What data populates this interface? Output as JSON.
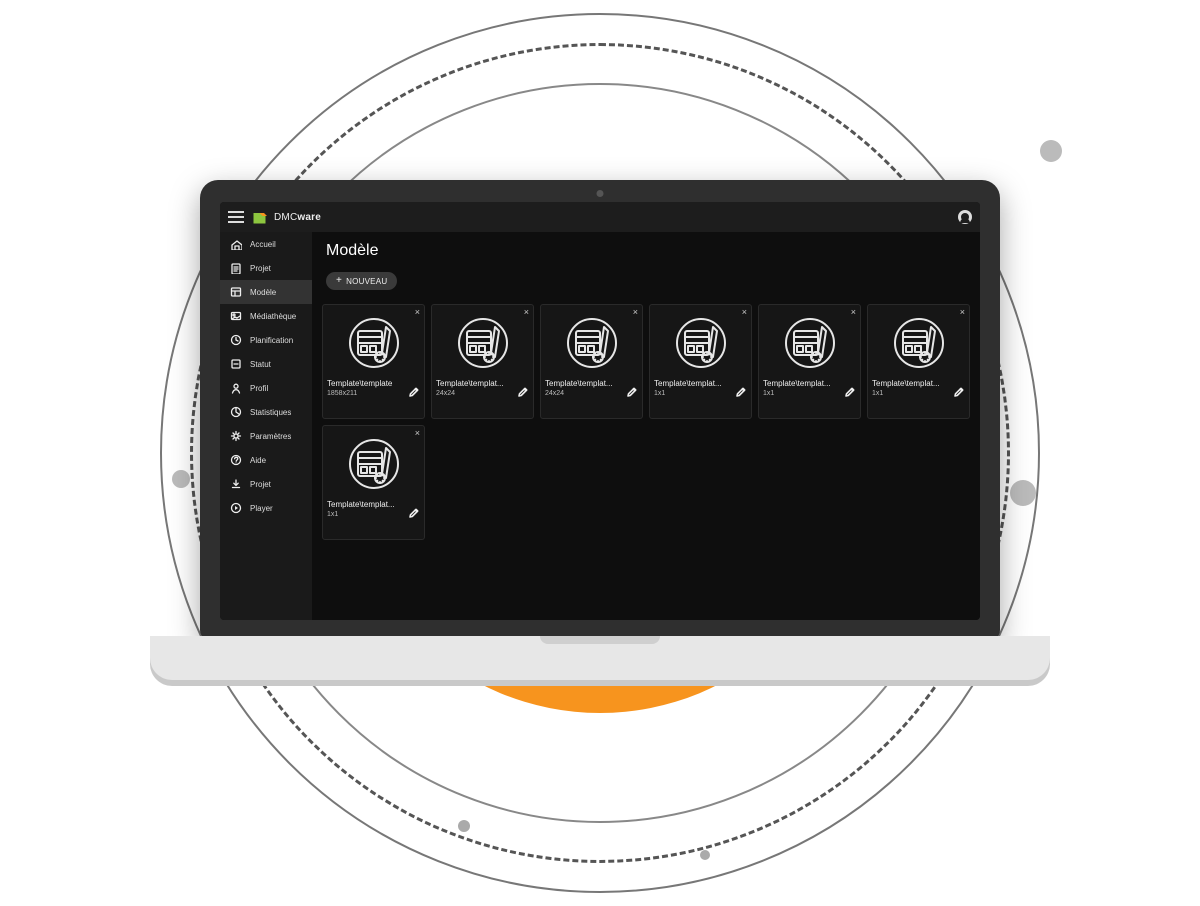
{
  "brand": {
    "prefix": "DMC",
    "suffix": "ware"
  },
  "page": {
    "title": "Modèle"
  },
  "toolbar": {
    "new_label": "NOUVEAU"
  },
  "sidebar": {
    "items": [
      {
        "id": "home",
        "label": "Accueil",
        "icon": "home-icon"
      },
      {
        "id": "projet",
        "label": "Projet",
        "icon": "project-icon"
      },
      {
        "id": "modele",
        "label": "Modèle",
        "icon": "template-icon",
        "active": true
      },
      {
        "id": "media",
        "label": "Médiathèque",
        "icon": "media-icon"
      },
      {
        "id": "planif",
        "label": "Planification",
        "icon": "clock-icon"
      },
      {
        "id": "statut",
        "label": "Statut",
        "icon": "status-icon"
      },
      {
        "id": "profil",
        "label": "Profil",
        "icon": "user-icon"
      },
      {
        "id": "stats",
        "label": "Statistiques",
        "icon": "stats-icon"
      },
      {
        "id": "params",
        "label": "Paramètres",
        "icon": "gear-icon"
      },
      {
        "id": "aide",
        "label": "Aide",
        "icon": "help-icon"
      },
      {
        "id": "projet2",
        "label": "Projet",
        "icon": "download-icon"
      },
      {
        "id": "player",
        "label": "Player",
        "icon": "play-icon"
      }
    ]
  },
  "templates": [
    {
      "name": "Template\\template",
      "dim": "1858x211"
    },
    {
      "name": "Template\\templat...",
      "dim": "24x24"
    },
    {
      "name": "Template\\templat...",
      "dim": "24x24"
    },
    {
      "name": "Template\\templat...",
      "dim": "1x1"
    },
    {
      "name": "Template\\templat...",
      "dim": "1x1"
    },
    {
      "name": "Template\\templat...",
      "dim": "1x1"
    },
    {
      "name": "Template\\templat...",
      "dim": "1x1"
    }
  ]
}
